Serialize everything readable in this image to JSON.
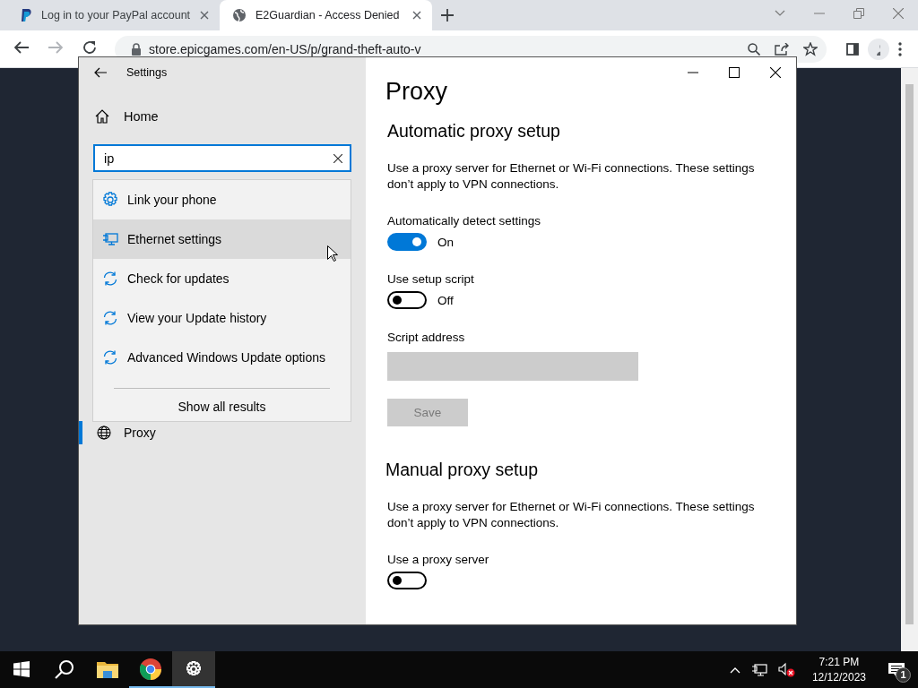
{
  "browser": {
    "tabs": [
      {
        "title": "Log in to your PayPal account",
        "selected": false,
        "kind": "paypal"
      },
      {
        "title": "E2Guardian - Access Denied",
        "selected": true,
        "kind": "globe"
      }
    ],
    "url": "store.epicgames.com/en-US/p/grand-theft-auto-v"
  },
  "settings_window": {
    "title": "Settings",
    "home": "Home",
    "search": {
      "value": "ip"
    },
    "search_results": [
      {
        "label": "Link your phone",
        "kind": "gear",
        "selected": false
      },
      {
        "label": "Ethernet settings",
        "kind": "monitor",
        "selected": true
      },
      {
        "label": "Check for updates",
        "kind": "sync",
        "selected": false
      },
      {
        "label": "View your Update history",
        "kind": "sync",
        "selected": false
      },
      {
        "label": "Advanced Windows Update options",
        "kind": "sync",
        "selected": false
      }
    ],
    "show_all": "Show all results",
    "sidebar_items": [
      {
        "label": "Proxy",
        "selected": true
      }
    ],
    "page_title": "Proxy",
    "sections": [
      {
        "heading": "Automatic proxy setup",
        "description": "Use a proxy server for Ethernet or Wi-Fi connections. These settings don’t apply to VPN connections.",
        "controls": [
          {
            "kind": "toggle",
            "label": "Automatically detect settings",
            "on": true,
            "state_text": "On"
          },
          {
            "kind": "toggle",
            "label": "Use setup script",
            "on": false,
            "state_text": "Off"
          },
          {
            "kind": "field",
            "label": "Script address",
            "disabled": true
          },
          {
            "kind": "button",
            "label": "Save",
            "disabled": true
          }
        ]
      },
      {
        "heading": "Manual proxy setup",
        "description": "Use a proxy server for Ethernet or Wi-Fi connections. These settings don’t apply to VPN connections.",
        "controls": [
          {
            "kind": "toggle",
            "label": "Use a proxy server",
            "on": false
          }
        ]
      }
    ]
  },
  "taskbar": {
    "items": [
      {
        "kind": "start",
        "selected": false,
        "running": false
      },
      {
        "kind": "search",
        "selected": false,
        "running": false
      },
      {
        "kind": "folder",
        "selected": false,
        "running": false
      },
      {
        "kind": "chrome",
        "selected": false,
        "running": true
      },
      {
        "kind": "gear",
        "selected": true,
        "running": true
      }
    ],
    "time": "7:21 PM",
    "date": "12/12/2023",
    "notifications": "1"
  }
}
